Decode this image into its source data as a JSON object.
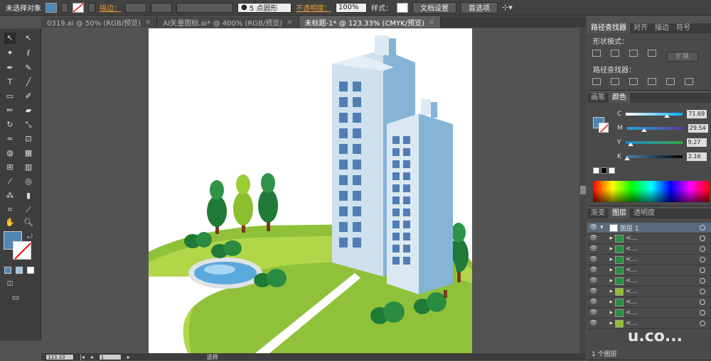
{
  "control_bar": {
    "selection_status": "未选择对象",
    "stroke_label": "描边：",
    "brush_label": "5 点圆形",
    "opacity_label": "不透明度：",
    "opacity_value": "100%",
    "style_label": "样式：",
    "doc_setup_button": "文档设置",
    "preferences_button": "首选项"
  },
  "doc_tabs": [
    {
      "label": "0319.ai @ 50% (RGB/预览)",
      "close": "×"
    },
    {
      "label": "AI矢量图标.ai* @ 400% (RGB/预览)",
      "close": "×"
    },
    {
      "label": "未标题-1* @ 123.33% (CMYK/预览)",
      "close": "×"
    }
  ],
  "status_bar": {
    "zoom": "123.33",
    "page": "1",
    "tool_name": "选择"
  },
  "pathfinder_panel": {
    "tabs": [
      "路径查找器",
      "对齐",
      "描边",
      "符号"
    ],
    "shape_modes_label": "形状模式：",
    "pathfinders_label": "路径查找器：",
    "expand_button": "扩展"
  },
  "color_panel": {
    "tabs": [
      "画笔",
      "颜色"
    ],
    "channels": [
      {
        "name": "C",
        "value": "71.69",
        "fraction": 0.72
      },
      {
        "name": "M",
        "value": "29.54",
        "fraction": 0.3
      },
      {
        "name": "Y",
        "value": "9.27",
        "fraction": 0.09
      },
      {
        "name": "K",
        "value": "2.16",
        "fraction": 0.02
      }
    ],
    "fill_color": "#4f86b4"
  },
  "layers_panel": {
    "tabs": [
      "渐变",
      "图层",
      "透明度"
    ],
    "top_layer": "图层 1",
    "sublayer_label": "<...",
    "footer": "1 个图层"
  },
  "watermark": "u.co..."
}
